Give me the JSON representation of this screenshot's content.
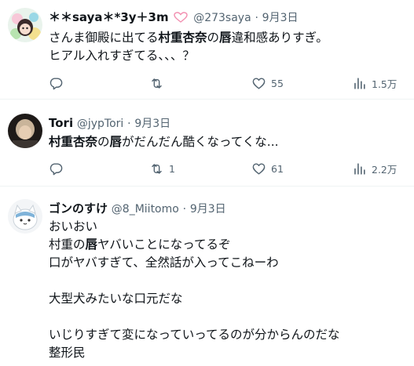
{
  "tweets": [
    {
      "name": "＊＊saya＊*3y＋3m",
      "handle": "@273saya",
      "date": "9月3日",
      "body_a": "さんま御殿に出てる",
      "body_b": "村重杏奈",
      "body_c": "の",
      "body_d": "唇",
      "body_e": "違和感ありすぎ。",
      "body_line2": "ヒアル入れすぎてる、、、？",
      "replies": "",
      "retweets": "",
      "likes": "55",
      "views": "1.5万"
    },
    {
      "name": "Tori",
      "handle": "@jypTori",
      "date": "9月3日",
      "body_a": "村重杏奈",
      "body_b": "の",
      "body_c": "唇",
      "body_d": "がだんだん酷くなってくな...",
      "replies": "",
      "retweets": "1",
      "likes": "61",
      "views": "2.2万"
    },
    {
      "name": "ゴンのすけ",
      "handle": "@8_Miitomo",
      "date": "9月3日",
      "l1": "おいおい",
      "l2a": "村重の",
      "l2b": "唇",
      "l2c": "ヤバいことになってるぞ",
      "l3": "口がヤバすぎて、全然話が入ってこねーわ",
      "l4": "大型犬みたいな口元だな",
      "l5": "いじりすぎて変になっていってるのが分からんのだな",
      "l6": "整形民"
    }
  ],
  "icons": {
    "reply": "reply-icon",
    "retweet": "retweet-icon",
    "like": "heart-icon",
    "views": "views-icon"
  },
  "colors": {
    "secondary_text": "#536471",
    "divider": "#eff3f4",
    "heart_pink": "#f28fb0"
  }
}
